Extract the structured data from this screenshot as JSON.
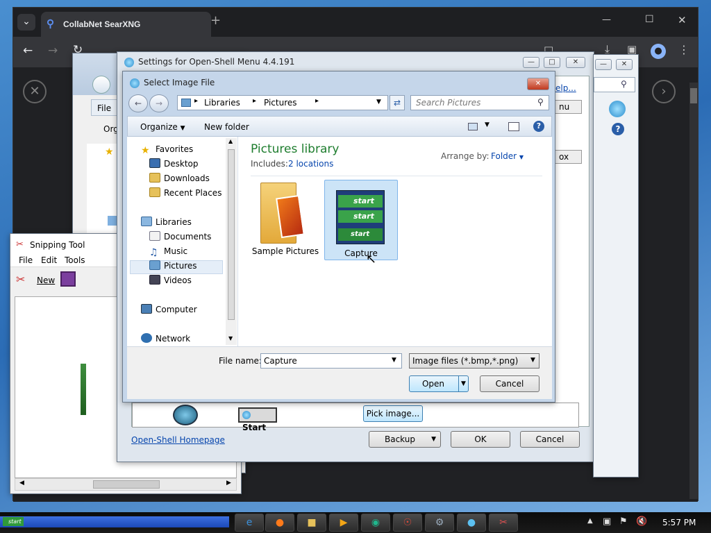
{
  "browser": {
    "tab_title": "CollabNet SearXNG",
    "new_tab": "+",
    "win_min": "—",
    "win_max": "☐",
    "win_close": "✕",
    "menu_dropdown": "⌄"
  },
  "background_explorer": {
    "file_menu": "File",
    "organize": "Org"
  },
  "snipping_tool": {
    "title": "Snipping Tool",
    "menu": [
      "File",
      "Edit",
      "Tools"
    ],
    "new_label": "New"
  },
  "settings": {
    "title": "Settings for Open-Shell Menu 4.4.191",
    "help_link": "elp...",
    "menu_fragment": "nu",
    "box_fragment": "ox",
    "start_button_label": "Start",
    "pick_image": "Pick image...",
    "homepage_link": "Open-Shell Homepage",
    "backup": "Backup",
    "ok": "OK",
    "cancel": "Cancel"
  },
  "dialog": {
    "title": "Select Image File",
    "breadcrumb": [
      "Libraries",
      "Pictures"
    ],
    "search_placeholder": "Search Pictures",
    "organize": "Organize",
    "new_folder": "New folder",
    "library_title": "Pictures library",
    "includes_label": "Includes:",
    "includes_link": "2 locations",
    "arrange_label": "Arrange by:",
    "arrange_value": "Folder",
    "nav": {
      "favorites": "Favorites",
      "desktop": "Desktop",
      "downloads": "Downloads",
      "recent": "Recent Places",
      "libraries": "Libraries",
      "documents": "Documents",
      "music": "Music",
      "pictures": "Pictures",
      "videos": "Videos",
      "computer": "Computer",
      "network": "Network"
    },
    "items": [
      "Sample Pictures",
      "Capture"
    ],
    "start_words": [
      "start",
      "start",
      "start"
    ],
    "filename_label": "File name:",
    "filename_value": "Capture",
    "filetype_value": "Image files (*.bmp,*.png)",
    "open": "Open",
    "cancel": "Cancel"
  },
  "taskbar": {
    "start_label": "start",
    "time": "5:57 PM"
  },
  "colors": {
    "accent_green": "#1e7d2e",
    "link_blue": "#0645ad",
    "selection": "#cce4f7"
  }
}
